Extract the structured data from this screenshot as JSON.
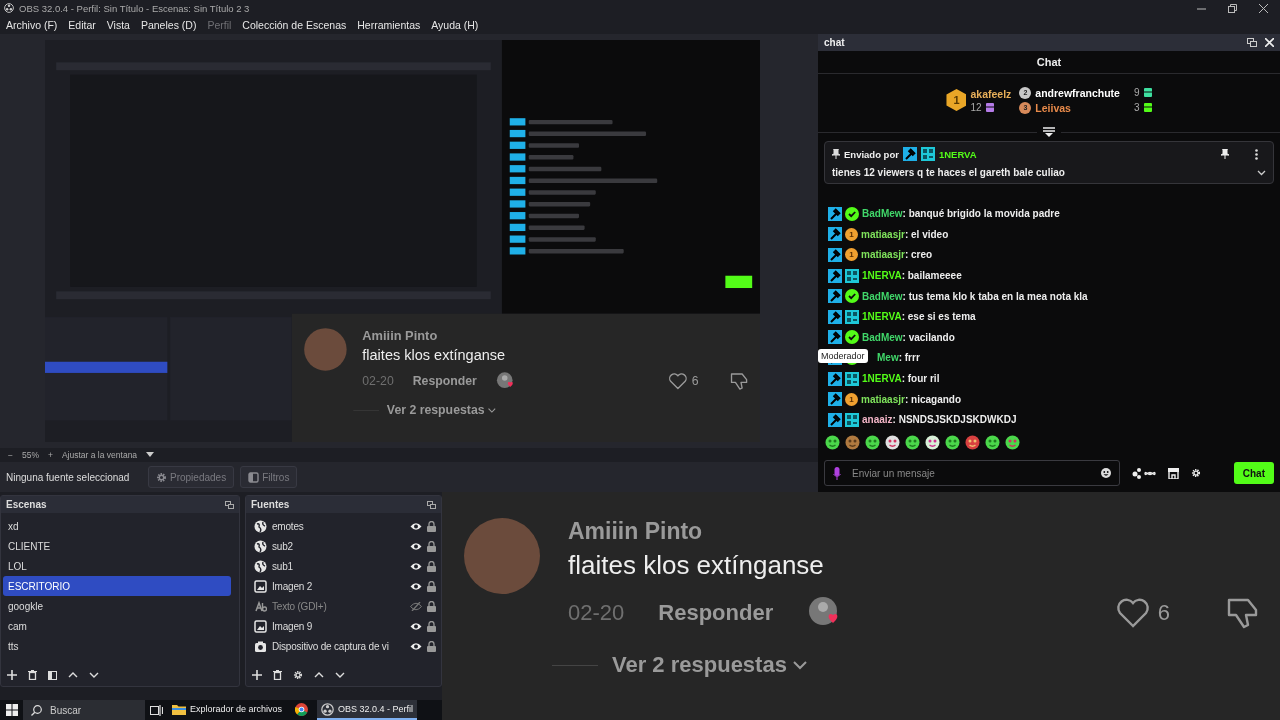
{
  "screen": {
    "title": "OBS 32.0.4 - Perfil: Sin Título - Escenas: Sin Título 2 3",
    "menu": [
      {
        "label": "Archivo (F)",
        "disabled": false
      },
      {
        "label": "Editar",
        "disabled": false
      },
      {
        "label": "Vista",
        "disabled": false
      },
      {
        "label": "Paneles (D)",
        "disabled": false
      },
      {
        "label": "Perfil",
        "disabled": true
      },
      {
        "label": "Colección de Escenas",
        "disabled": false
      },
      {
        "label": "Herramientas",
        "disabled": false
      },
      {
        "label": "Ayuda (H)",
        "disabled": false
      }
    ],
    "preview": {
      "capture": {
        "comment": {
          "author": "Amiiin Pinto",
          "text": "flaites klos extínganse",
          "date": "02-20",
          "reply": "Responder",
          "likes": "6",
          "more": "Ver 2 respuestas"
        }
      }
    },
    "zoom_bar": {
      "minus": "−",
      "value": "55%",
      "plus": "+",
      "fit": "Ajustar a la ventana"
    },
    "source_toolbar": {
      "label": "Ninguna fuente seleccionad",
      "buttons": [
        {
          "label": "Propiedades",
          "kind": "properties",
          "disabled": true
        },
        {
          "label": "Filtros",
          "kind": "filters",
          "disabled": true
        }
      ]
    },
    "scenes": {
      "title": "Escenas",
      "items": [
        {
          "name": "xd",
          "selected": false
        },
        {
          "name": "CLIENTE",
          "selected": false
        },
        {
          "name": "LOL",
          "selected": false
        },
        {
          "name": "ESCRITORIO",
          "selected": true
        },
        {
          "name": "googkle",
          "selected": false
        },
        {
          "name": "cam",
          "selected": false
        },
        {
          "name": "tts",
          "selected": false
        }
      ]
    },
    "sources": {
      "title": "Fuentes",
      "items": [
        {
          "name": "emotes",
          "kind": "browser",
          "visible": true
        },
        {
          "name": "sub2",
          "kind": "browser",
          "visible": true
        },
        {
          "name": "sub1",
          "kind": "browser",
          "visible": true
        },
        {
          "name": "Imagen 2",
          "kind": "image",
          "visible": true
        },
        {
          "name": "Texto (GDI+)",
          "kind": "text",
          "visible": false
        },
        {
          "name": "Imagen 9",
          "kind": "image",
          "visible": true
        },
        {
          "name": "Dispositivo de captura de vi",
          "kind": "camera",
          "visible": true
        }
      ]
    },
    "taskbar": {
      "search": {
        "placeholder": "Buscar"
      },
      "apps": [
        {
          "label": "Explorador de archivos",
          "kind": "explorer",
          "selected": false
        },
        {
          "kind": "chrome",
          "selected": false
        },
        {
          "label": "OBS 32.0.4 - Perfil",
          "kind": "obs",
          "selected": true
        }
      ]
    },
    "chat": {
      "dock_title": "chat",
      "title": "Chat",
      "leaders": [
        {
          "rank": "1",
          "name": "akafeelz",
          "count": "12",
          "color": "#e8b05a"
        },
        {
          "rank": "2",
          "name": "andrewfranchute",
          "count": "9",
          "color": "#ffffff"
        },
        {
          "rank": "3",
          "name": "Leiivas",
          "count": "3",
          "color": "#e88a4a"
        }
      ],
      "pinned": {
        "prefix": "Enviado por",
        "badges": [
          {
            "kind": "mod"
          },
          {
            "kind": "pixel"
          }
        ],
        "user": "1NERVA",
        "color": "#53fc18",
        "text": "tienes 12 viewers q te haces el gareth bale culiao"
      },
      "messages": [
        {
          "badges": [
            {
              "kind": "mod"
            },
            {
              "kind": "verified"
            }
          ],
          "user": "BadMew",
          "color": "#41d86a",
          "text": ": banqué brigido la movida padre"
        },
        {
          "badges": [
            {
              "kind": "mod"
            },
            {
              "kind": "sub",
              "text": "1"
            }
          ],
          "user": "matiaasjr",
          "color": "#7fe35c",
          "text": ": el video"
        },
        {
          "badges": [
            {
              "kind": "mod"
            },
            {
              "kind": "sub",
              "text": "1"
            }
          ],
          "user": "matiaasjr",
          "color": "#7fe35c",
          "text": ": creo"
        },
        {
          "badges": [
            {
              "kind": "mod"
            },
            {
              "kind": "pixel"
            }
          ],
          "user": "1NERVA",
          "color": "#53fc18",
          "text": ": bailameeee"
        },
        {
          "badges": [
            {
              "kind": "mod"
            },
            {
              "kind": "verified"
            }
          ],
          "user": "BadMew",
          "color": "#41d86a",
          "text": ": tus tema klo k taba en la mea nota kla"
        },
        {
          "badges": [
            {
              "kind": "mod"
            },
            {
              "kind": "pixel"
            }
          ],
          "user": "1NERVA",
          "color": "#53fc18",
          "text": ": ese si es tema"
        },
        {
          "badges": [
            {
              "kind": "mod"
            },
            {
              "kind": "verified"
            }
          ],
          "user": "BadMew",
          "color": "#41d86a",
          "text": ": vacilando"
        },
        {
          "badges": [
            {
              "kind": "mod"
            },
            {
              "kind": "verified"
            }
          ],
          "user": "Mew",
          "color": "#41d86a",
          "text": ": frrr",
          "tooltip": "Moderador"
        },
        {
          "badges": [
            {
              "kind": "mod"
            },
            {
              "kind": "pixel"
            }
          ],
          "user": "1NERVA",
          "color": "#53fc18",
          "text": ": four ril"
        },
        {
          "badges": [
            {
              "kind": "mod"
            },
            {
              "kind": "sub",
              "text": "1"
            }
          ],
          "user": "matiaasjr",
          "color": "#7fe35c",
          "text": ": nicagando"
        },
        {
          "badges": [
            {
              "kind": "mod"
            },
            {
              "kind": "pixel"
            }
          ],
          "user": "anaaiz",
          "color": "#f4b6c8",
          "text": ": NSNDSJSKDJSKDWKDJ"
        }
      ],
      "input": {
        "placeholder": "Enviar un mensaje"
      },
      "send": "Chat"
    },
    "comment": {
      "author": "Amiiin Pinto",
      "text": "flaites klos extínganse",
      "date": "02-20",
      "reply": "Responder",
      "likes": "6",
      "more": "Ver 2 respuestas"
    }
  }
}
